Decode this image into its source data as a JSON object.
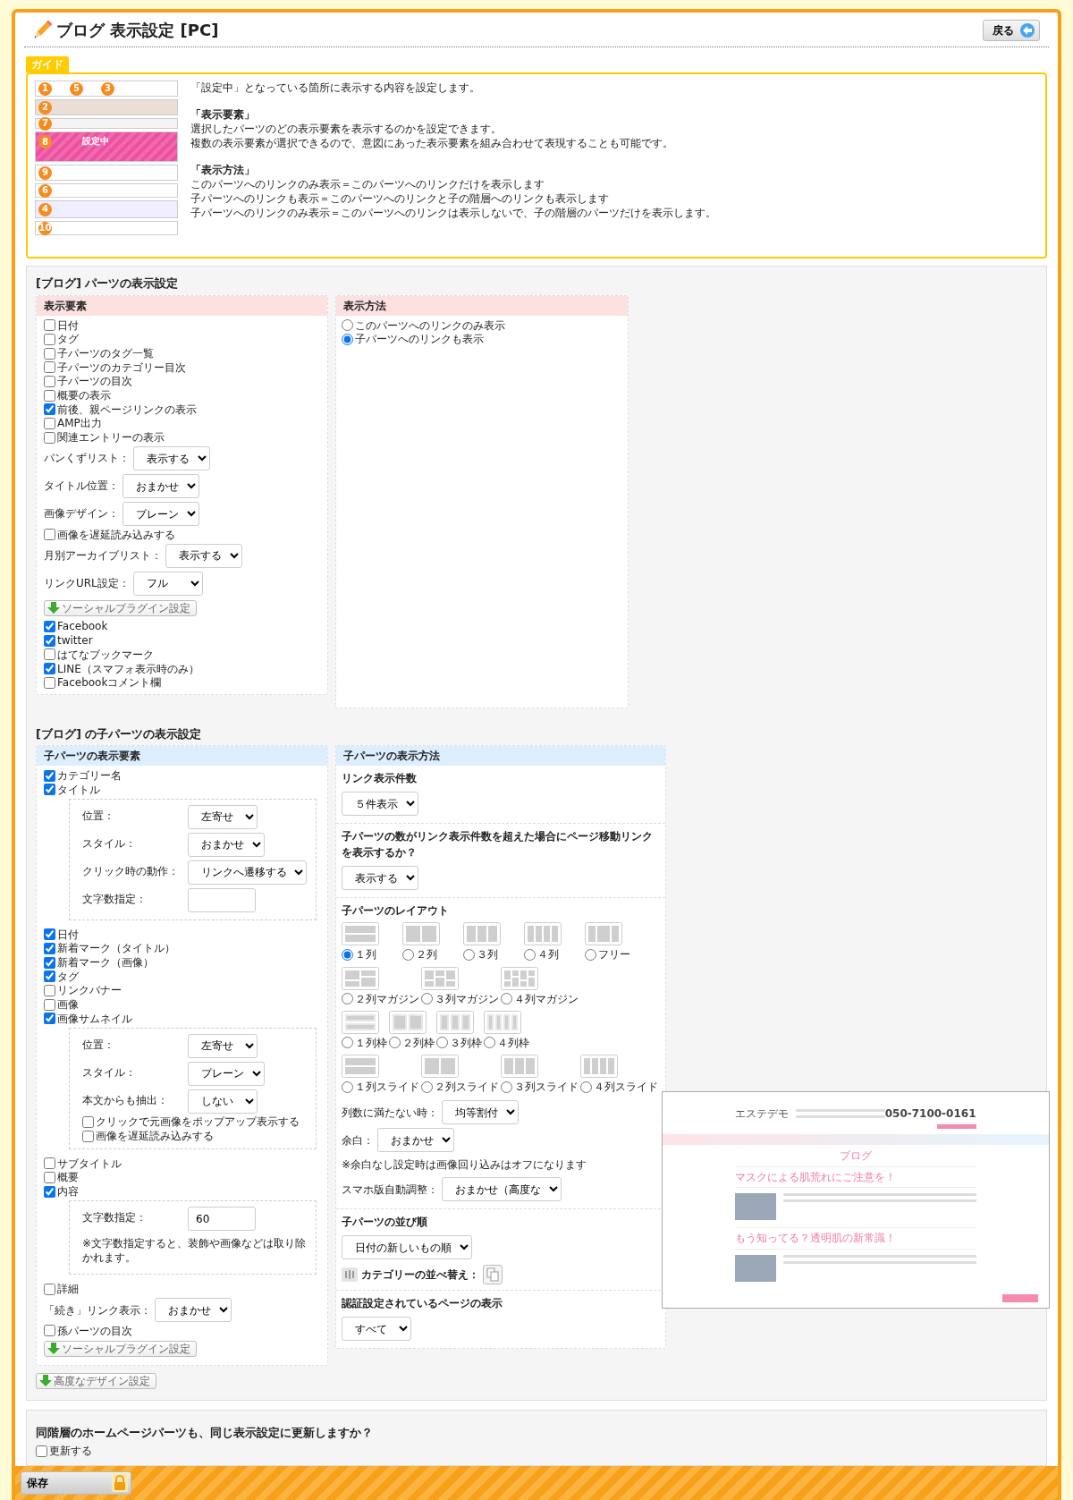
{
  "header": {
    "title": "ブログ 表示設定 [PC]",
    "back_button": "戻る"
  },
  "guide": {
    "tag": "ガイド",
    "thumbnail": {
      "badges": [
        "1",
        "5",
        "3",
        "2",
        "7",
        "8",
        "9",
        "6",
        "4",
        "10"
      ],
      "active_label": "設定中"
    },
    "blocks": [
      {
        "lines": [
          "「設定中」となっている箇所に表示する内容を設定します。"
        ]
      },
      {
        "heading": "「表示要素」",
        "lines": [
          "選択したパーツのどの表示要素を表示するのかを設定できます。",
          "複数の表示要素が選択できるので、意図にあった表示要素を組み合わせて表現することも可能です。"
        ]
      },
      {
        "heading": "「表示方法」",
        "lines": [
          "このパーツへのリンクのみ表示＝このパーツへのリンクだけを表示します",
          "子パーツへのリンクも表示＝このパーツへのリンクと子の階層へのリンクも表示します",
          "子パーツへのリンクのみ表示＝このパーツへのリンクは表示しないで、子の階層のパーツだけを表示します。"
        ]
      }
    ]
  },
  "section": {
    "title": "[ブログ] パーツの表示設定",
    "elements_panel": {
      "title": "表示要素",
      "items": [
        {
          "kind": "checkbox",
          "label": "日付",
          "checked": false
        },
        {
          "kind": "checkbox",
          "label": "タグ",
          "checked": false
        },
        {
          "kind": "checkbox",
          "label": "子パーツのタグ一覧",
          "checked": false
        },
        {
          "kind": "checkbox",
          "label": "子パーツのカテゴリー目次",
          "checked": false
        },
        {
          "kind": "checkbox",
          "label": "子パーツの目次",
          "checked": false
        },
        {
          "kind": "checkbox",
          "label": "概要の表示",
          "checked": false
        },
        {
          "kind": "checkbox",
          "label": "前後、親ページリンクの表示",
          "checked": true
        },
        {
          "kind": "checkbox",
          "label": "AMP出力",
          "checked": false
        },
        {
          "kind": "checkbox",
          "label": "関連エントリーの表示",
          "checked": false
        },
        {
          "kind": "select",
          "label": "パンくずリスト：",
          "value": "表示する"
        },
        {
          "kind": "select",
          "label": "タイトル位置：",
          "value": "おまかせ"
        },
        {
          "kind": "select",
          "label": "画像デザイン：",
          "value": "プレーン"
        },
        {
          "kind": "checkbox",
          "label": "画像を遅延読み込みする",
          "checked": false
        },
        {
          "kind": "select",
          "label": "月別アーカイブリスト：",
          "value": "表示する"
        },
        {
          "kind": "select",
          "label": "リンクURL設定：",
          "value": "フル"
        },
        {
          "kind": "button",
          "label": "ソーシャルプラグイン設定"
        },
        {
          "kind": "checkbox",
          "label": "Facebook",
          "checked": true
        },
        {
          "kind": "checkbox",
          "label": "twitter",
          "checked": true
        },
        {
          "kind": "checkbox",
          "label": "はてなブックマーク",
          "checked": false
        },
        {
          "kind": "checkbox",
          "label": "LINE（スマフォ表示時のみ）",
          "checked": true
        },
        {
          "kind": "checkbox",
          "label": "Facebookコメント欄",
          "checked": false
        }
      ]
    },
    "method_panel": {
      "title": "表示方法",
      "options": [
        {
          "label": "このパーツへのリンクのみ表示",
          "selected": false
        },
        {
          "label": "子パーツへのリンクも表示",
          "selected": true
        }
      ]
    }
  },
  "child_section": {
    "title": "[ブログ] の子パーツの表示設定",
    "elements_panel": {
      "title": "子パーツの表示要素",
      "items": [
        {
          "kind": "checkbox",
          "label": "カテゴリー名",
          "checked": true
        },
        {
          "kind": "checkbox",
          "label": "タイトル",
          "checked": true,
          "options": [
            {
              "kind": "select",
              "label": "位置：",
              "value": "左寄せ"
            },
            {
              "kind": "select",
              "label": "スタイル：",
              "value": "おまかせ"
            },
            {
              "kind": "select",
              "label": "クリック時の動作：",
              "value": "リンクへ遷移する"
            },
            {
              "kind": "input",
              "label": "文字数指定："
            }
          ]
        },
        {
          "kind": "checkbox",
          "label": "日付",
          "checked": true
        },
        {
          "kind": "checkbox",
          "label": "新着マーク（タイトル）",
          "checked": true
        },
        {
          "kind": "checkbox",
          "label": "新着マーク（画像）",
          "checked": true
        },
        {
          "kind": "checkbox",
          "label": "タグ",
          "checked": true
        },
        {
          "kind": "checkbox",
          "label": "リンクバナー",
          "checked": false
        },
        {
          "kind": "checkbox",
          "label": "画像",
          "checked": false
        },
        {
          "kind": "checkbox",
          "label": "画像サムネイル",
          "checked": true,
          "options": [
            {
              "kind": "select",
              "label": "位置：",
              "value": "左寄せ"
            },
            {
              "kind": "select",
              "label": "スタイル：",
              "value": "プレーン"
            },
            {
              "kind": "select",
              "label": "本文からも抽出：",
              "value": "しない"
            },
            {
              "kind": "checkbox",
              "label": "クリックで元画像をポップアップ表示する",
              "checked": false
            },
            {
              "kind": "checkbox",
              "label": "画像を遅延読み込みする",
              "checked": false
            }
          ]
        },
        {
          "kind": "checkbox",
          "label": "サブタイトル",
          "checked": false
        },
        {
          "kind": "checkbox",
          "label": "概要",
          "checked": false
        },
        {
          "kind": "checkbox",
          "label": "内容",
          "checked": true,
          "options": [
            {
              "kind": "input",
              "label": "文字数指定：",
              "value": "60"
            },
            {
              "kind": "note",
              "text": "※文字数指定すると、装飾や画像などは取り除かれます。"
            }
          ]
        },
        {
          "kind": "checkbox",
          "label": "詳細",
          "checked": false
        },
        {
          "kind": "select",
          "label": "「続き」リンク表示：",
          "value": "おまかせ"
        },
        {
          "kind": "checkbox",
          "label": "孫パーツの目次",
          "checked": false
        },
        {
          "kind": "button",
          "label": "ソーシャルプラグイン設定"
        }
      ]
    },
    "method_panel": {
      "title": "子パーツの表示方法",
      "blocks": [
        {
          "heading": "リンク表示件数",
          "items": [
            {
              "kind": "select",
              "value": "５件表示"
            }
          ]
        },
        {
          "heading": "子パーツの数がリンク表示件数を超えた場合にページ移動リンクを表示するか？",
          "items": [
            {
              "kind": "select",
              "value": "表示する"
            }
          ]
        },
        {
          "heading": "子パーツのレイアウト",
          "items": [
            {
              "kind": "layout_row",
              "options": [
                {
                  "label": "１列",
                  "kind": "col1",
                  "selected": true
                },
                {
                  "label": "２列",
                  "kind": "col2",
                  "selected": false
                },
                {
                  "label": "３列",
                  "kind": "col3",
                  "selected": false
                },
                {
                  "label": "４列",
                  "kind": "col4",
                  "selected": false
                },
                {
                  "label": "フリー",
                  "kind": "free",
                  "selected": false
                }
              ]
            },
            {
              "kind": "layout_row",
              "options": [
                {
                  "label": "２列マガジン",
                  "kind": "mag2",
                  "selected": false
                },
                {
                  "label": "３列マガジン",
                  "kind": "mag3",
                  "selected": false
                },
                {
                  "label": "４列マガジン",
                  "kind": "mag4",
                  "selected": false
                }
              ]
            },
            {
              "kind": "layout_row",
              "options": [
                {
                  "label": "１列枠",
                  "kind": "frame1",
                  "selected": false
                },
                {
                  "label": "２列枠",
                  "kind": "frame2",
                  "selected": false
                },
                {
                  "label": "３列枠",
                  "kind": "frame3",
                  "selected": false
                },
                {
                  "label": "４列枠",
                  "kind": "frame4",
                  "selected": false
                }
              ]
            },
            {
              "kind": "layout_row",
              "options": [
                {
                  "label": "１列スライド",
                  "kind": "slide1",
                  "selected": false
                },
                {
                  "label": "２列スライド",
                  "kind": "slide2",
                  "selected": false
                },
                {
                  "label": "３列スライド",
                  "kind": "slide3",
                  "selected": false
                },
                {
                  "label": "４列スライド",
                  "kind": "slide4",
                  "selected": false
                }
              ]
            },
            {
              "kind": "select",
              "label": "列数に満たない時：",
              "value": "均等割付"
            },
            {
              "kind": "select",
              "label": "余白：",
              "value": "おまかせ"
            },
            {
              "kind": "note",
              "text": "※余白なし設定時は画像回り込みはオフになります"
            },
            {
              "kind": "select",
              "label": "スマホ版自動調整：",
              "value": "おまかせ（高度な"
            }
          ]
        },
        {
          "heading": "子パーツの並び順",
          "items": [
            {
              "kind": "select",
              "value": "日付の新しいもの順"
            },
            {
              "kind": "sort",
              "label": "カテゴリーの並べ替え："
            }
          ]
        },
        {
          "heading": "認証設定されているページの表示",
          "items": [
            {
              "kind": "select",
              "value": "すべて"
            }
          ]
        }
      ]
    },
    "preview": {
      "site_name": "エステデモ",
      "phone": "050-7100-0161",
      "page_title": "ブログ",
      "posts": [
        {
          "title": "マスクによる肌荒れにご注意を！"
        },
        {
          "title": "もう知ってる？透明肌の新常識！"
        }
      ]
    }
  },
  "advanced_button": "高度なデザイン設定",
  "sync": {
    "question": "同階層のホームページパーツも、同じ表示設定に更新しますか？",
    "checkbox": {
      "label": "更新する",
      "checked": false
    }
  },
  "footer": {
    "save_button": "保存"
  }
}
